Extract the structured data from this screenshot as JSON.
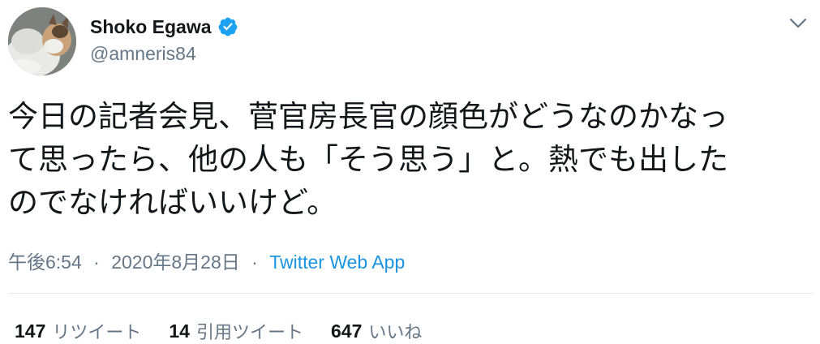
{
  "author": {
    "display_name": "Shoko Egawa",
    "handle": "@amneris84",
    "verified": true
  },
  "tweet": {
    "lines": [
      "今日の記者会見、菅官房長官の顔色がどうなのかなっ",
      "て思ったら、他の人も「そう思う」と。熱でも出した",
      "のでなければいいけど。"
    ],
    "time": "午後6:54",
    "separator": "·",
    "date": "2020年8月28日",
    "source": "Twitter Web App"
  },
  "stats": {
    "retweets": {
      "count": "147",
      "label": "リツイート"
    },
    "quotes": {
      "count": "14",
      "label": "引用ツイート"
    },
    "likes": {
      "count": "647",
      "label": "いいね"
    }
  },
  "colors": {
    "text": "#14171a",
    "secondary": "#657786",
    "link": "#1b95e0",
    "verified": "#1da1f2",
    "divider": "#e6ecf0"
  },
  "icons": {
    "verified": "verified-badge-icon",
    "caret": "chevron-down-icon"
  }
}
